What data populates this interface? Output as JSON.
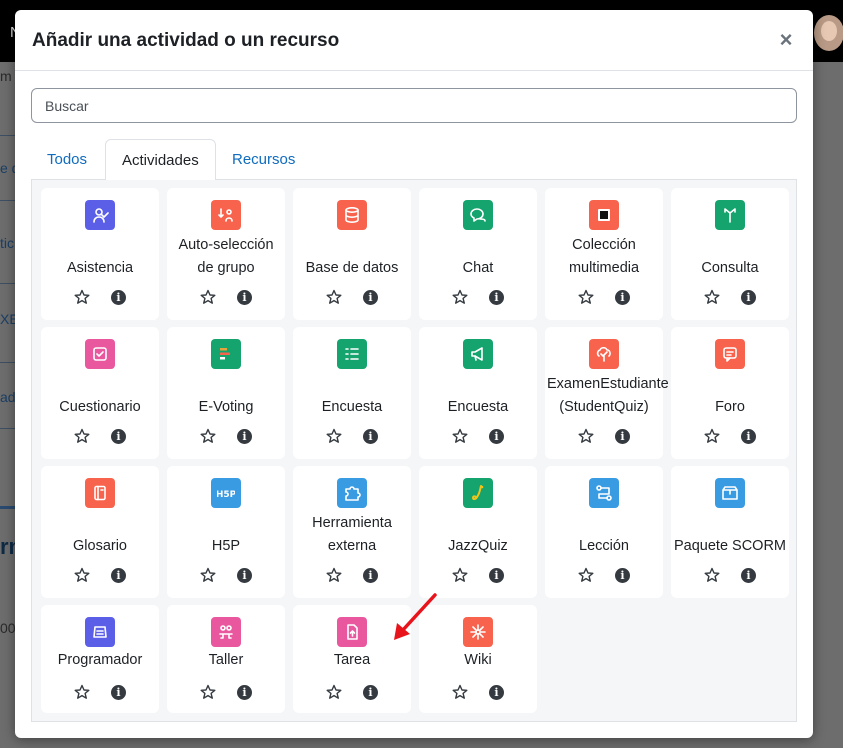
{
  "background": {
    "top_letter": "N",
    "frags": [
      "m e",
      "e d",
      "tic",
      "XE",
      "ad",
      "rm",
      "00"
    ]
  },
  "modal": {
    "title": "Añadir una actividad o un recurso",
    "close_symbol": "×"
  },
  "search": {
    "placeholder": "Buscar",
    "value": ""
  },
  "tabs": [
    {
      "label": "Todos",
      "active": false
    },
    {
      "label": "Actividades",
      "active": true
    },
    {
      "label": "Recursos",
      "active": false
    }
  ],
  "colors": {
    "administration": "#5b5fe8",
    "communication": "#f7634d",
    "collaboration": "#15a36e",
    "assessment": "#e9579e",
    "content": "#399be2",
    "interactive": "#e9579e",
    "accent": "#0f6cbf"
  },
  "activities": [
    {
      "name": "Asistencia",
      "icon": "attendance-icon",
      "color": "#5b5fe8"
    },
    {
      "name": "Auto-selección de grupo",
      "icon": "group-select-icon",
      "color": "#f7634d"
    },
    {
      "name": "Base de datos",
      "icon": "database-icon",
      "color": "#f7634d"
    },
    {
      "name": "Chat",
      "icon": "chat-icon",
      "color": "#15a36e"
    },
    {
      "name": "Colección multimedia",
      "icon": "media-collection-icon",
      "color": "#f7634d"
    },
    {
      "name": "Consulta",
      "icon": "choice-icon",
      "color": "#15a36e"
    },
    {
      "name": "Cuestionario",
      "icon": "quiz-icon",
      "color": "#e9579e"
    },
    {
      "name": "E-Voting",
      "icon": "evoting-icon",
      "color": "#15a36e"
    },
    {
      "name": "Encuesta",
      "icon": "survey-list-icon",
      "color": "#15a36e"
    },
    {
      "name": "Encuesta",
      "icon": "megaphone-icon",
      "color": "#15a36e"
    },
    {
      "name": "ExamenEstudiante (StudentQuiz)",
      "icon": "studentquiz-icon",
      "color": "#f7634d"
    },
    {
      "name": "Foro",
      "icon": "forum-icon",
      "color": "#f7634d"
    },
    {
      "name": "Glosario",
      "icon": "glossary-icon",
      "color": "#f7634d"
    },
    {
      "name": "H5P",
      "icon": "h5p-icon",
      "color": "#399be2"
    },
    {
      "name": "Herramienta externa",
      "icon": "puzzle-icon",
      "color": "#399be2"
    },
    {
      "name": "JazzQuiz",
      "icon": "saxophone-icon",
      "color": "#15a36e"
    },
    {
      "name": "Lección",
      "icon": "lesson-icon",
      "color": "#399be2"
    },
    {
      "name": "Paquete SCORM",
      "icon": "scorm-package-icon",
      "color": "#399be2"
    },
    {
      "name": "Programador",
      "icon": "scheduler-icon",
      "color": "#5b5fe8"
    },
    {
      "name": "Taller",
      "icon": "workshop-icon",
      "color": "#e9579e"
    },
    {
      "name": "Tarea",
      "icon": "assignment-icon",
      "color": "#e9579e"
    },
    {
      "name": "Wiki",
      "icon": "wiki-icon",
      "color": "#f7634d"
    }
  ],
  "card_actions": {
    "star_icon": "star-icon",
    "info_icon": "info-icon",
    "info_glyph": "i"
  },
  "annotation": {
    "icon": "red-arrow-icon",
    "color": "#e8141b"
  }
}
